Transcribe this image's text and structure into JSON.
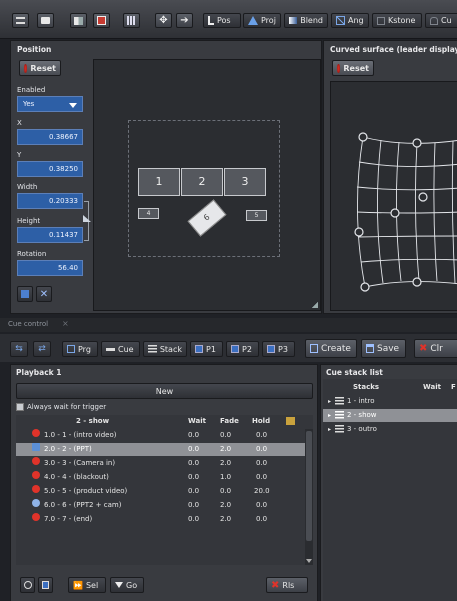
{
  "colors": {
    "accent": "#2d5fa6",
    "stop": "#e0332a",
    "selected": "#8f9196"
  },
  "toolbar": {
    "icons": [
      "menu-icon",
      "monitor-icon",
      "split-screen-icon",
      "video-clip-icon",
      "grid-icon",
      "move-icon",
      "arrow-right-icon"
    ],
    "tabs": [
      {
        "icon": "position-icon",
        "label": "Pos"
      },
      {
        "icon": "projection-icon",
        "label": "Proj"
      },
      {
        "icon": "blend-icon",
        "label": "Blend"
      },
      {
        "icon": "angle-icon",
        "label": "Ang"
      },
      {
        "icon": "keystone-icon",
        "label": "Kstone"
      },
      {
        "icon": "curve-icon",
        "label": "Cu"
      }
    ]
  },
  "position": {
    "title": "Position",
    "reset": "Reset",
    "enabled_label": "Enabled",
    "enabled_value": "Yes",
    "x_label": "X",
    "x_value": "0.38667",
    "y_label": "Y",
    "y_value": "0.38250",
    "width_label": "Width",
    "width_value": "0.20333",
    "height_label": "Height",
    "height_value": "0.11437",
    "rotation_label": "Rotation",
    "rotation_value": "56.40",
    "screens": [
      "1",
      "2",
      "3"
    ],
    "small_screens": [
      "4",
      "5"
    ],
    "rotated_screen": "6"
  },
  "curved": {
    "title": "Curved surface (leader display)",
    "reset": "Reset"
  },
  "cue_control": {
    "title": "Cue control",
    "buttons": [
      {
        "icon": "list-icon",
        "label": "Prg"
      },
      {
        "icon": "cue-icon",
        "label": "Cue"
      },
      {
        "icon": "stack-icon",
        "label": "Stack"
      },
      {
        "icon": "page-icon",
        "label": "P1"
      },
      {
        "icon": "page-icon",
        "label": "P2"
      },
      {
        "icon": "page-icon",
        "label": "P3"
      }
    ],
    "create": "Create",
    "save": "Save",
    "clear": "Clr"
  },
  "playback": {
    "title": "Playback 1",
    "new_label": "New",
    "always_wait": "Always wait for trigger",
    "col_name": "2 - show",
    "col_wait": "Wait",
    "col_fade": "Fade",
    "col_hold": "Hold",
    "rows": [
      {
        "name": "1.0 - 1 - (intro video)",
        "wait": "0.0",
        "fade": "0.0",
        "hold": "0.0",
        "dot": "#e0332a"
      },
      {
        "name": "2.0 - 2 - (PPT)",
        "wait": "0.0",
        "fade": "2.0",
        "hold": "0.0",
        "dot": "#5b8fd6"
      },
      {
        "name": "3.0 - 3 - (Camera in)",
        "wait": "0.0",
        "fade": "2.0",
        "hold": "0.0",
        "dot": "#e0332a"
      },
      {
        "name": "4.0 - 4 - (blackout)",
        "wait": "0.0",
        "fade": "1.0",
        "hold": "0.0",
        "dot": "#e0332a"
      },
      {
        "name": "5.0 - 5 - (product video)",
        "wait": "0.0",
        "fade": "0.0",
        "hold": "20.0",
        "dot": "#e0332a"
      },
      {
        "name": "6.0 - 6 - (PPT2 + cam)",
        "wait": "0.0",
        "fade": "2.0",
        "hold": "0.0",
        "dot": "#8fb3e8"
      },
      {
        "name": "7.0 - 7 - (end)",
        "wait": "0.0",
        "fade": "2.0",
        "hold": "0.0",
        "dot": "#e0332a"
      }
    ],
    "sel": "Sel",
    "go": "Go",
    "rls": "Rls"
  },
  "cue_stack": {
    "title": "Cue stack list",
    "col_stacks": "Stacks",
    "col_wait": "Wait",
    "col_fade": "F",
    "rows": [
      {
        "name": "1 - intro"
      },
      {
        "name": "2 - show"
      },
      {
        "name": "3 - outro"
      }
    ]
  }
}
